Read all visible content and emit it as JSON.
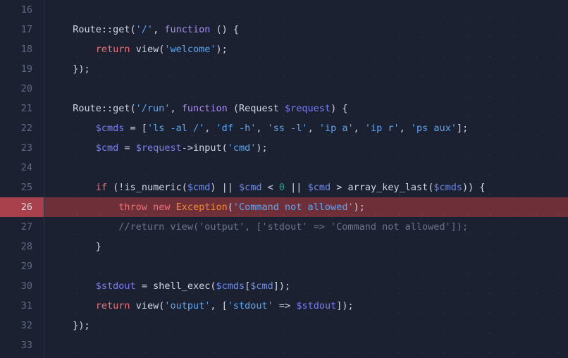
{
  "editor": {
    "name": "code-editor",
    "language": "php",
    "theme": {
      "background": "#1b2130",
      "gutter_text": "#5f6b85",
      "text": "#cfd6e6",
      "keyword": "#f07178",
      "keyword_alt": "#a98cf3",
      "variable": "#7b7ef0",
      "string": "#5ba7f7",
      "number": "#26a18f",
      "class_name": "#f08a3c",
      "comment": "#6b7689",
      "highlight_gutter": "#a8414b",
      "highlight_line": "#6f2f38"
    },
    "highlighted_line": 26,
    "first_visible_line": 16,
    "last_visible_line": 33,
    "lines": [
      {
        "number": "16",
        "text": "",
        "tokens": []
      },
      {
        "number": "17",
        "text": "  Route::get('/', function () {",
        "tokens": [
          {
            "t": "  Route::get(",
            "c": "t-plain"
          },
          {
            "t": "'/'",
            "c": "t-str"
          },
          {
            "t": ", ",
            "c": "t-plain"
          },
          {
            "t": "function",
            "c": "t-kw2"
          },
          {
            "t": " () {",
            "c": "t-plain"
          }
        ]
      },
      {
        "number": "18",
        "text": "      return view('welcome');",
        "tokens": [
          {
            "t": "      ",
            "c": "t-plain"
          },
          {
            "t": "return",
            "c": "t-kw"
          },
          {
            "t": " view(",
            "c": "t-plain"
          },
          {
            "t": "'welcome'",
            "c": "t-str"
          },
          {
            "t": ");",
            "c": "t-plain"
          }
        ]
      },
      {
        "number": "19",
        "text": "  });",
        "tokens": [
          {
            "t": "  });",
            "c": "t-plain"
          }
        ]
      },
      {
        "number": "20",
        "text": "",
        "tokens": []
      },
      {
        "number": "21",
        "text": "  Route::get('/run', function (Request $request) {",
        "tokens": [
          {
            "t": "  Route::get(",
            "c": "t-plain"
          },
          {
            "t": "'/run'",
            "c": "t-str"
          },
          {
            "t": ", ",
            "c": "t-plain"
          },
          {
            "t": "function",
            "c": "t-kw2"
          },
          {
            "t": " (Request ",
            "c": "t-plain"
          },
          {
            "t": "$request",
            "c": "t-var"
          },
          {
            "t": ") {",
            "c": "t-plain"
          }
        ]
      },
      {
        "number": "22",
        "text": "      $cmds = ['ls -al /', 'df -h', 'ss -l', 'ip a', 'ip r', 'ps aux'];",
        "tokens": [
          {
            "t": "      ",
            "c": "t-plain"
          },
          {
            "t": "$cmds",
            "c": "t-var"
          },
          {
            "t": " = [",
            "c": "t-plain"
          },
          {
            "t": "'ls -al /'",
            "c": "t-str"
          },
          {
            "t": ", ",
            "c": "t-plain"
          },
          {
            "t": "'df -h'",
            "c": "t-str"
          },
          {
            "t": ", ",
            "c": "t-plain"
          },
          {
            "t": "'ss -l'",
            "c": "t-str"
          },
          {
            "t": ", ",
            "c": "t-plain"
          },
          {
            "t": "'ip a'",
            "c": "t-str"
          },
          {
            "t": ", ",
            "c": "t-plain"
          },
          {
            "t": "'ip r'",
            "c": "t-str"
          },
          {
            "t": ", ",
            "c": "t-plain"
          },
          {
            "t": "'ps aux'",
            "c": "t-str"
          },
          {
            "t": "];",
            "c": "t-plain"
          }
        ]
      },
      {
        "number": "23",
        "text": "      $cmd = $request->input('cmd');",
        "tokens": [
          {
            "t": "      ",
            "c": "t-plain"
          },
          {
            "t": "$cmd",
            "c": "t-var"
          },
          {
            "t": " = ",
            "c": "t-plain"
          },
          {
            "t": "$request",
            "c": "t-var"
          },
          {
            "t": "->input(",
            "c": "t-plain"
          },
          {
            "t": "'cmd'",
            "c": "t-str"
          },
          {
            "t": ");",
            "c": "t-plain"
          }
        ]
      },
      {
        "number": "24",
        "text": "",
        "tokens": []
      },
      {
        "number": "25",
        "text": "      if (!is_numeric($cmd) || $cmd < 0 || $cmd > array_key_last($cmds)) {",
        "tokens": [
          {
            "t": "      ",
            "c": "t-plain"
          },
          {
            "t": "if",
            "c": "t-kw"
          },
          {
            "t": " (!is_numeric(",
            "c": "t-plain"
          },
          {
            "t": "$cmd",
            "c": "t-var2"
          },
          {
            "t": ") || ",
            "c": "t-plain"
          },
          {
            "t": "$cmd",
            "c": "t-var2"
          },
          {
            "t": " < ",
            "c": "t-plain"
          },
          {
            "t": "0",
            "c": "t-num"
          },
          {
            "t": " || ",
            "c": "t-plain"
          },
          {
            "t": "$cmd",
            "c": "t-var2"
          },
          {
            "t": " > array_key_last(",
            "c": "t-plain"
          },
          {
            "t": "$cmds",
            "c": "t-var2"
          },
          {
            "t": ")) {",
            "c": "t-plain"
          }
        ]
      },
      {
        "number": "26",
        "text": "          throw new Exception('Command not allowed');",
        "highlight": true,
        "tokens": [
          {
            "t": "          ",
            "c": "t-plain"
          },
          {
            "t": "throw",
            "c": "t-kw"
          },
          {
            "t": " ",
            "c": "t-plain"
          },
          {
            "t": "new",
            "c": "t-kw"
          },
          {
            "t": " ",
            "c": "t-plain"
          },
          {
            "t": "Exception",
            "c": "t-cls"
          },
          {
            "t": "(",
            "c": "t-plain"
          },
          {
            "t": "'Command not allowed'",
            "c": "t-str"
          },
          {
            "t": ");",
            "c": "t-plain"
          }
        ]
      },
      {
        "number": "27",
        "text": "          //return view('output', ['stdout' => 'Command not allowed']);",
        "tokens": [
          {
            "t": "          ",
            "c": "t-plain"
          },
          {
            "t": "//return view('output', ['stdout' => 'Command not allowed']);",
            "c": "t-comment"
          }
        ]
      },
      {
        "number": "28",
        "text": "      }",
        "tokens": [
          {
            "t": "      }",
            "c": "t-plain"
          }
        ]
      },
      {
        "number": "29",
        "text": "",
        "tokens": []
      },
      {
        "number": "30",
        "text": "      $stdout = shell_exec($cmds[$cmd]);",
        "tokens": [
          {
            "t": "      ",
            "c": "t-plain"
          },
          {
            "t": "$stdout",
            "c": "t-var"
          },
          {
            "t": " = shell_exec(",
            "c": "t-plain"
          },
          {
            "t": "$cmds",
            "c": "t-var2"
          },
          {
            "t": "[",
            "c": "t-plain"
          },
          {
            "t": "$cmd",
            "c": "t-var2"
          },
          {
            "t": "]);",
            "c": "t-plain"
          }
        ]
      },
      {
        "number": "31",
        "text": "      return view('output', ['stdout' => $stdout]);",
        "tokens": [
          {
            "t": "      ",
            "c": "t-plain"
          },
          {
            "t": "return",
            "c": "t-kw"
          },
          {
            "t": " view(",
            "c": "t-plain"
          },
          {
            "t": "'output'",
            "c": "t-str"
          },
          {
            "t": ", [",
            "c": "t-plain"
          },
          {
            "t": "'stdout'",
            "c": "t-str"
          },
          {
            "t": " => ",
            "c": "t-plain"
          },
          {
            "t": "$stdout",
            "c": "t-var"
          },
          {
            "t": "]);",
            "c": "t-plain"
          }
        ]
      },
      {
        "number": "32",
        "text": "  });",
        "tokens": [
          {
            "t": "  });",
            "c": "t-plain"
          }
        ]
      },
      {
        "number": "33",
        "text": "",
        "tokens": []
      }
    ]
  }
}
